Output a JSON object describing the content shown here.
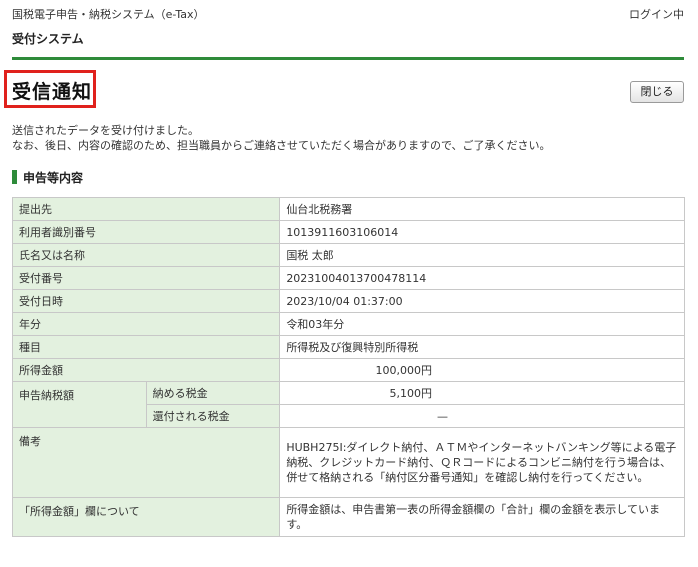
{
  "header": {
    "system_name": "国税電子申告・納税システム（e-Tax）",
    "login_status": "ログイン中",
    "subsystem": "受付システム"
  },
  "page": {
    "title": "受信通知",
    "close_label": "閉じる",
    "message_line1": "送信されたデータを受け付けました。",
    "message_line2": "なお、後日、内容の確認のため、担当職員からご連絡させていただく場合がありますので、ご了承ください。"
  },
  "section": {
    "heading": "申告等内容"
  },
  "table": {
    "office_label": "提出先",
    "office_value": "仙台北税務署",
    "user_id_label": "利用者識別番号",
    "user_id_value": "1013911603106014",
    "name_label": "氏名又は名称",
    "name_value": "国税 太郎",
    "receipt_no_label": "受付番号",
    "receipt_no_value": "20231004013700478114",
    "receipt_time_label": "受付日時",
    "receipt_time_value": "2023/10/04 01:37:00",
    "year_label": "年分",
    "year_value": "令和03年分",
    "type_label": "種目",
    "type_value": "所得税及び復興特別所得税",
    "income_label": "所得金額",
    "income_value": "100,000円",
    "tax_label": "申告納税額",
    "pay_tax_label": "納める税金",
    "pay_tax_value": "5,100円",
    "refund_tax_label": "還付される税金",
    "refund_tax_value": "—",
    "remarks_label": "備考",
    "remarks_value": "HUBH275I:ダイレクト納付、ＡＴＭやインターネットバンキング等による電子納税、クレジットカード納付、ＱＲコードによるコンビニ納付を行う場合は、併せて格納される「納付区分番号通知」を確認し納付を行ってください。",
    "about_income_label": "「所得金額」欄について",
    "about_income_value": "所得金額は、申告書第一表の所得金額欄の「合計」欄の金額を表示しています。"
  }
}
